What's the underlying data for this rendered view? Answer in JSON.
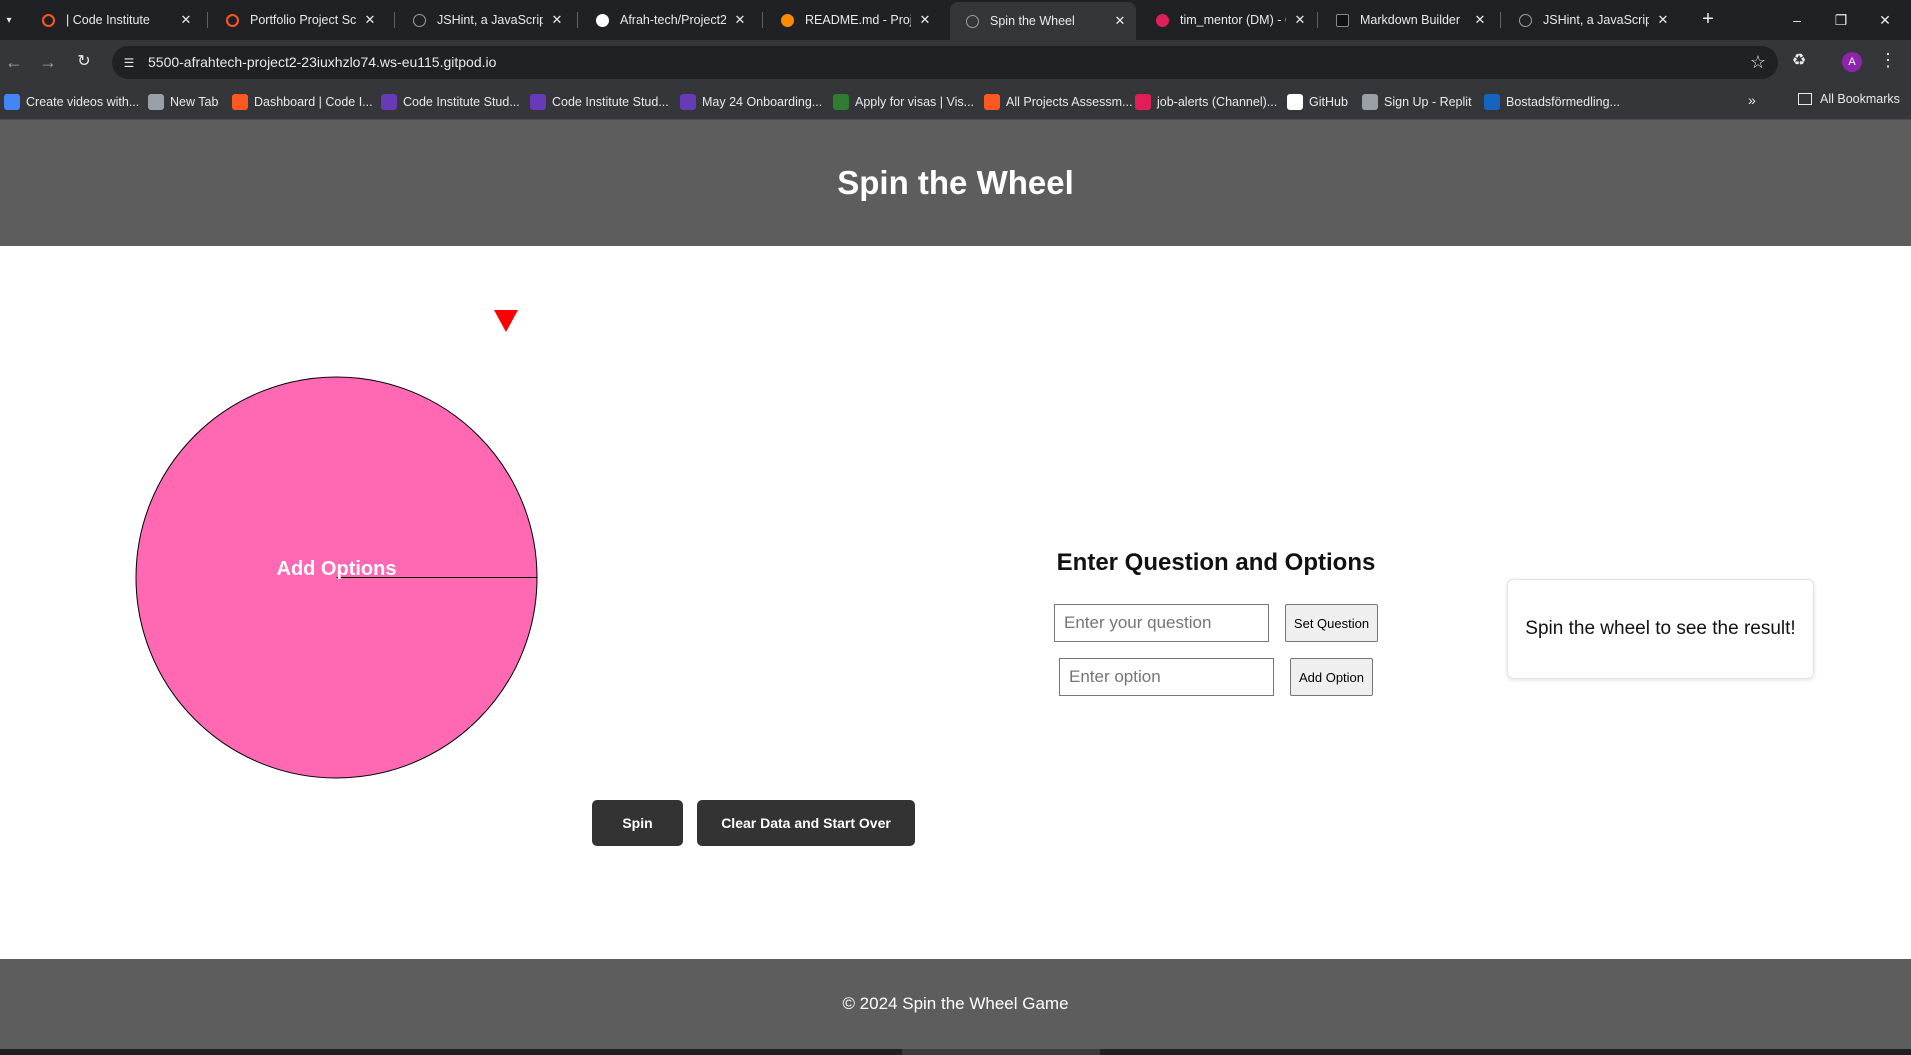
{
  "browser": {
    "tabs": [
      {
        "title": "| Code Institute",
        "icon": "code-institute-icon",
        "color": "#ff5722",
        "active": false
      },
      {
        "title": "Portfolio Project Scop",
        "icon": "code-institute-icon",
        "color": "#ff5722",
        "active": false
      },
      {
        "title": "JSHint, a JavaScript C",
        "icon": "globe-icon",
        "color": "#9aa0a6",
        "active": false
      },
      {
        "title": "Afrah-tech/Project2",
        "icon": "github-icon",
        "color": "#ffffff",
        "active": false
      },
      {
        "title": "README.md - Project",
        "icon": "gitpod-icon",
        "color": "#ff8a00",
        "active": false
      },
      {
        "title": "Spin the Wheel",
        "icon": "globe-icon",
        "color": "#9aa0a6",
        "active": true
      },
      {
        "title": "tim_mentor (DM) - Co",
        "icon": "slack-icon",
        "color": "#e01e5a",
        "active": false
      },
      {
        "title": "Markdown Builder",
        "icon": "markdown-icon",
        "color": "#111111",
        "active": false
      },
      {
        "title": "JSHint, a JavaScript C",
        "icon": "globe-icon",
        "color": "#9aa0a6",
        "active": false
      }
    ],
    "url": "5500-afrahtech-project2-23iuxhzlo74.ws-eu115.gitpod.io",
    "profile_initial": "A",
    "bookmarks": [
      {
        "label": "Create videos with...",
        "color": "#4285f4"
      },
      {
        "label": "New Tab",
        "color": "#9aa0a6"
      },
      {
        "label": "Dashboard | Code I...",
        "color": "#ff5722"
      },
      {
        "label": "Code Institute Stud...",
        "color": "#673ab7"
      },
      {
        "label": "Code Institute Stud...",
        "color": "#673ab7"
      },
      {
        "label": "May 24 Onboarding...",
        "color": "#673ab7"
      },
      {
        "label": "Apply for visas | Vis...",
        "color": "#2e7d32"
      },
      {
        "label": "All Projects Assessm...",
        "color": "#ff5722"
      },
      {
        "label": "job-alerts (Channel)...",
        "color": "#e01e5a"
      },
      {
        "label": "GitHub",
        "color": "#ffffff"
      },
      {
        "label": "Sign Up - Replit",
        "color": "#9aa0a6"
      },
      {
        "label": "Bostadsförmedling...",
        "color": "#1565c0"
      }
    ],
    "all_bookmarks_label": "All Bookmarks"
  },
  "page": {
    "title": "Spin the Wheel",
    "wheel": {
      "label": "Add Options",
      "fill_color": "#ff69b4",
      "pointer_color": "#ff0000"
    },
    "buttons": {
      "spin": "Spin",
      "clear": "Clear Data and Start Over"
    },
    "form": {
      "heading": "Enter Question and Options",
      "question_placeholder": "Enter your question",
      "set_question_label": "Set Question",
      "option_placeholder": "Enter option",
      "add_option_label": "Add Option"
    },
    "result_text": "Spin the wheel to see the result!",
    "footer_text": "© 2024 Spin the Wheel Game"
  }
}
